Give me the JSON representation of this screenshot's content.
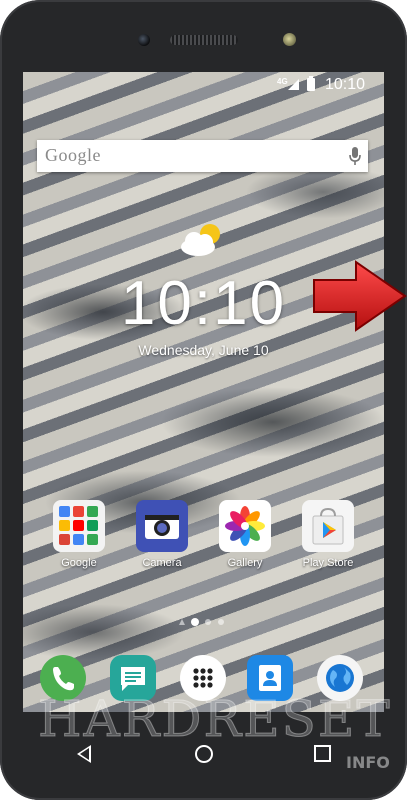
{
  "status_bar": {
    "network": "4G",
    "time": "10:10"
  },
  "search": {
    "label": "Google"
  },
  "clock": {
    "time": "10:10",
    "date": "Wednesday, June 10"
  },
  "apps": [
    {
      "label": "Google",
      "icon": "google-folder-icon"
    },
    {
      "label": "Camera",
      "icon": "camera-icon"
    },
    {
      "label": "Gallery",
      "icon": "gallery-icon"
    },
    {
      "label": "Play Store",
      "icon": "play-store-icon"
    }
  ],
  "page_indicator": {
    "pages": 3,
    "current": 1
  },
  "dock": [
    {
      "icon": "phone-icon",
      "color": "#4caf50"
    },
    {
      "icon": "messages-icon",
      "color": "#26a69a"
    },
    {
      "icon": "app-drawer-icon",
      "color": "#ffffff"
    },
    {
      "icon": "contacts-icon",
      "color": "#1e88e5"
    },
    {
      "icon": "browser-icon",
      "color": "#f5f5f5"
    }
  ],
  "watermark": {
    "text": "HARDRESET",
    "suffix": "INFO"
  },
  "colors": {
    "arrow": "#d71a1a",
    "bezel": "#262729"
  }
}
